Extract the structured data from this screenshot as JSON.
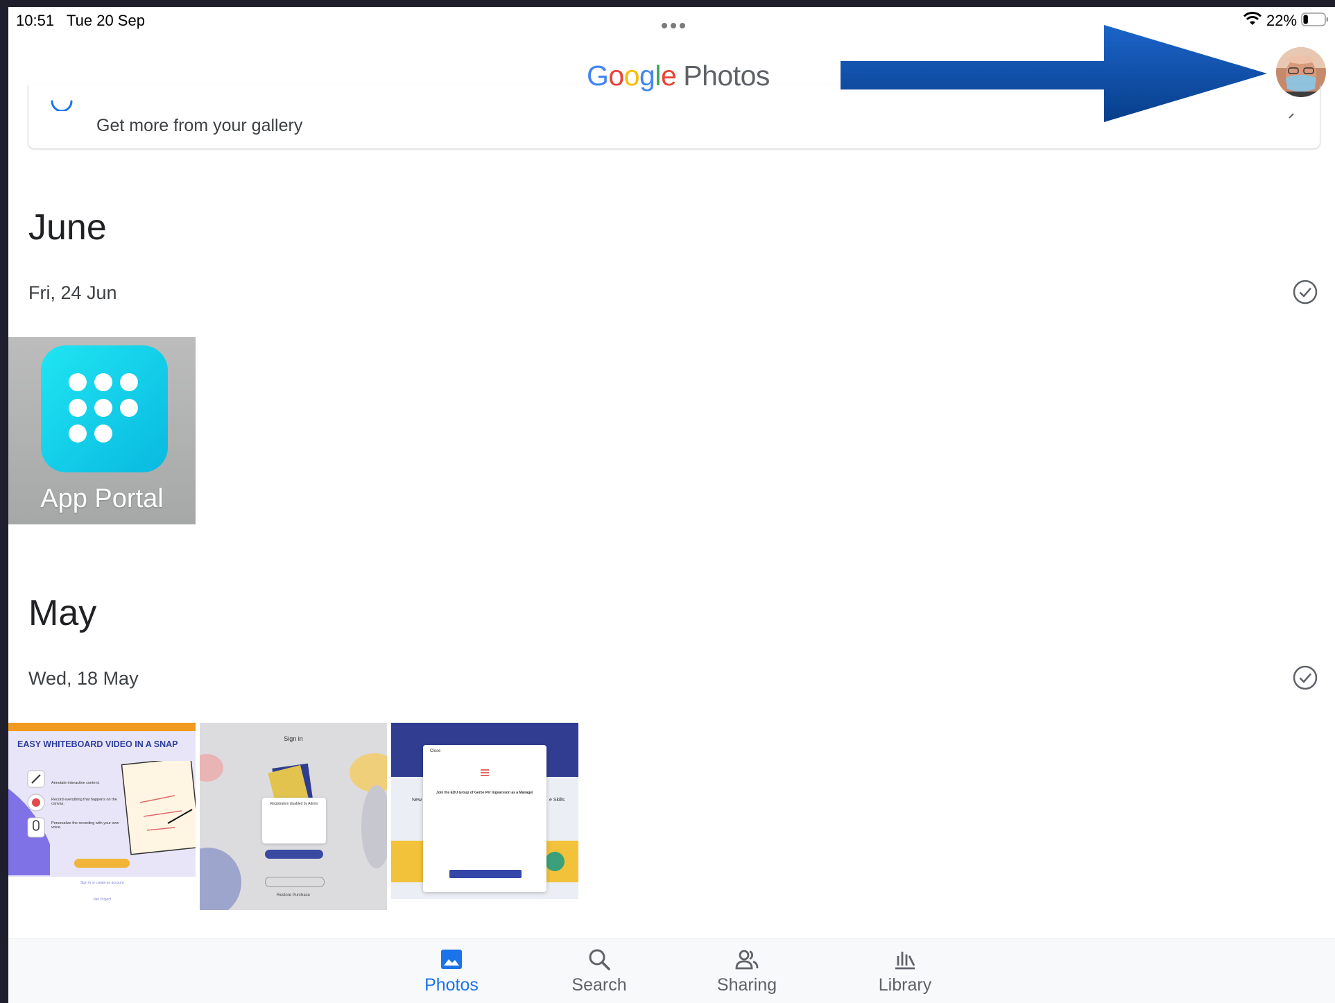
{
  "status_bar": {
    "time": "10:51",
    "date": "Tue 20 Sep",
    "battery_percent": "22%",
    "battery_level": 0.22
  },
  "header": {
    "logo_google": [
      "G",
      "o",
      "o",
      "g",
      "l",
      "e"
    ],
    "logo_photos": "Photos"
  },
  "banner": {
    "text": "Get more from your gallery"
  },
  "sections": [
    {
      "month": "June",
      "date": "Fri, 24 Jun",
      "photos": [
        {
          "type": "app-portal",
          "label": "App Portal"
        }
      ]
    },
    {
      "month": "May",
      "date": "Wed, 18 May",
      "photos": [
        {
          "type": "whiteboard",
          "title": "EASY WHITEBOARD VIDEO IN A SNAP",
          "lines": [
            "Annotate interactive content.",
            "Record everything that happens on the canvas.",
            "Personalize the recording with your own voice."
          ],
          "footer": [
            "Sign in or create an account",
            "Join Project"
          ]
        },
        {
          "type": "sign-in",
          "title": "Sign in",
          "dialog": "Registration disabled by Admin",
          "restore": "Restore Purchase"
        },
        {
          "type": "manager",
          "close": "Close",
          "heading": "Join the EDU Group of Gerbe Pér Ingvarsson as a Manager",
          "side_left": "New",
          "side_right": "e Skills"
        }
      ]
    }
  ],
  "bottom_nav": {
    "items": [
      {
        "label": "Photos",
        "icon": "photos-icon",
        "active": true
      },
      {
        "label": "Search",
        "icon": "search-icon",
        "active": false
      },
      {
        "label": "Sharing",
        "icon": "sharing-icon",
        "active": false
      },
      {
        "label": "Library",
        "icon": "library-icon",
        "active": false
      }
    ]
  },
  "colors": {
    "accent": "#1a73e8",
    "arrow": "#0b4ea2"
  }
}
